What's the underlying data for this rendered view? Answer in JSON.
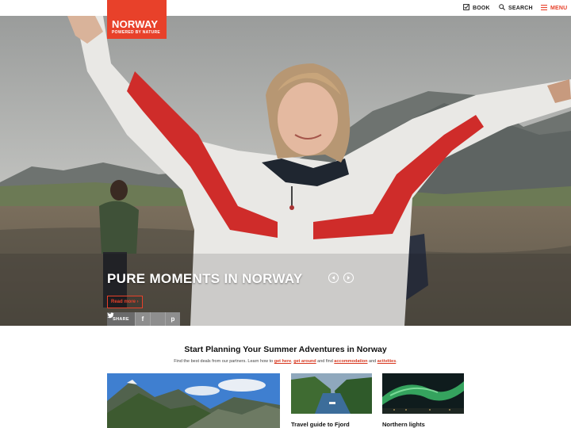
{
  "header": {
    "logo_title": "NORWAY",
    "logo_subtitle": "POWERED BY NATURE",
    "nav": {
      "book": "BOOK",
      "search": "SEARCH",
      "menu": "MENU"
    }
  },
  "hero": {
    "headline": "PURE MOMENTS IN NORWAY",
    "read_more": "Read more ›",
    "share_label": "SHARE",
    "share_buttons": [
      "f",
      "t",
      "p"
    ]
  },
  "planning": {
    "title": "Start Planning Your Summer Adventures in Norway",
    "sub_before": "Find the best deals from our partners. Learn how to ",
    "link_get_here": "get here",
    "sep1": ", ",
    "link_get_around": "get around",
    "sub_middle": " and find ",
    "link_accommodation": "accommodation",
    "sub_and": " and ",
    "link_activities": "activities",
    "sub_end": "."
  },
  "cards": [
    {
      "caption": ""
    },
    {
      "caption": "Travel guide to Fjord"
    },
    {
      "caption": "Northern lights"
    }
  ],
  "colors": {
    "brand_red": "#e8412a",
    "text_dark": "#111111"
  }
}
